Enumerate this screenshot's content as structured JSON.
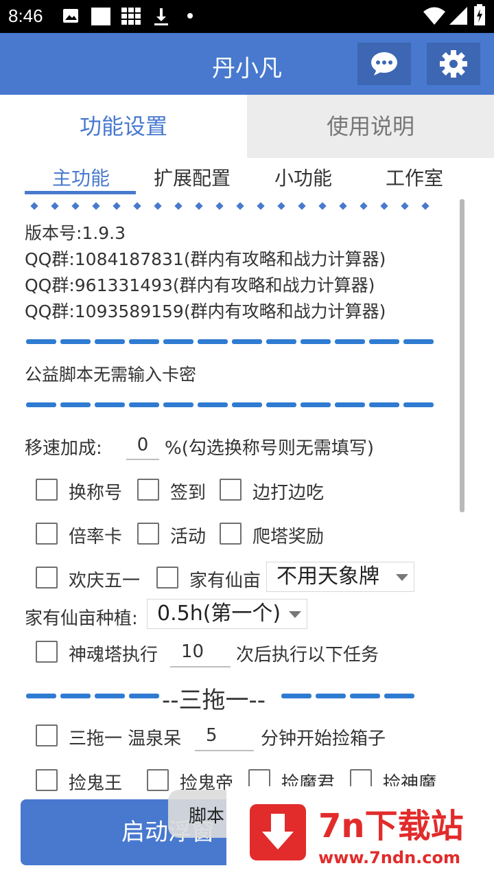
{
  "status_bar": {
    "time": "8:46"
  },
  "app_bar": {
    "title": "丹小凡",
    "chat_icon": "chat-bubble-icon",
    "settings_icon": "gear-icon"
  },
  "main_tabs": [
    {
      "label": "功能设置",
      "active": true
    },
    {
      "label": "使用说明",
      "active": false
    }
  ],
  "sub_tabs": [
    {
      "label": "主功能",
      "active": true
    },
    {
      "label": "扩展配置"
    },
    {
      "label": "小功能"
    },
    {
      "label": "工作室"
    }
  ],
  "info": {
    "version": "版本号:1.9.3",
    "qq1": "QQ群:1084187831(群内有攻略和战力计算器)",
    "qq2": "QQ群:961331493(群内有攻略和战力计算器)",
    "qq3": "QQ群:1093589159(群内有攻略和战力计算器)",
    "notice": "公益脚本无需输入卡密"
  },
  "speed": {
    "label": "移速加成:",
    "value": "0",
    "hint": "%(勾选换称号则无需填写)"
  },
  "checkboxes": {
    "row1": [
      "换称号",
      "签到",
      "边打边吃"
    ],
    "row2": [
      "倍率卡",
      "活动",
      "爬塔奖励"
    ],
    "row3": [
      "欢庆五一",
      "家有仙亩"
    ]
  },
  "tianxiang": {
    "selected": "不用天象牌"
  },
  "planting": {
    "label": "家有仙亩种植:",
    "selected": "0.5h(第一个)"
  },
  "tower": {
    "label_pre": "神魂塔执行",
    "value": "10",
    "label_post": "次后执行以下任务"
  },
  "section_title": "--三拖一--",
  "santuoyi": {
    "label": "三拖一 温泉呆",
    "value": "5",
    "label_post": "分钟开始捡箱子"
  },
  "pickup": [
    "捡鬼王",
    "捡鬼帝",
    "捡魔君",
    "捡神魔"
  ],
  "bottom": {
    "start_button": "启动浮窗",
    "float_tab": "脚本"
  },
  "watermark": {
    "title": "7n下载站",
    "url": "www.7ndn.com"
  },
  "colors": {
    "primary": "#4879cf",
    "accent_dash": "#2f7bd2",
    "watermark_red": "#e22b2b"
  }
}
